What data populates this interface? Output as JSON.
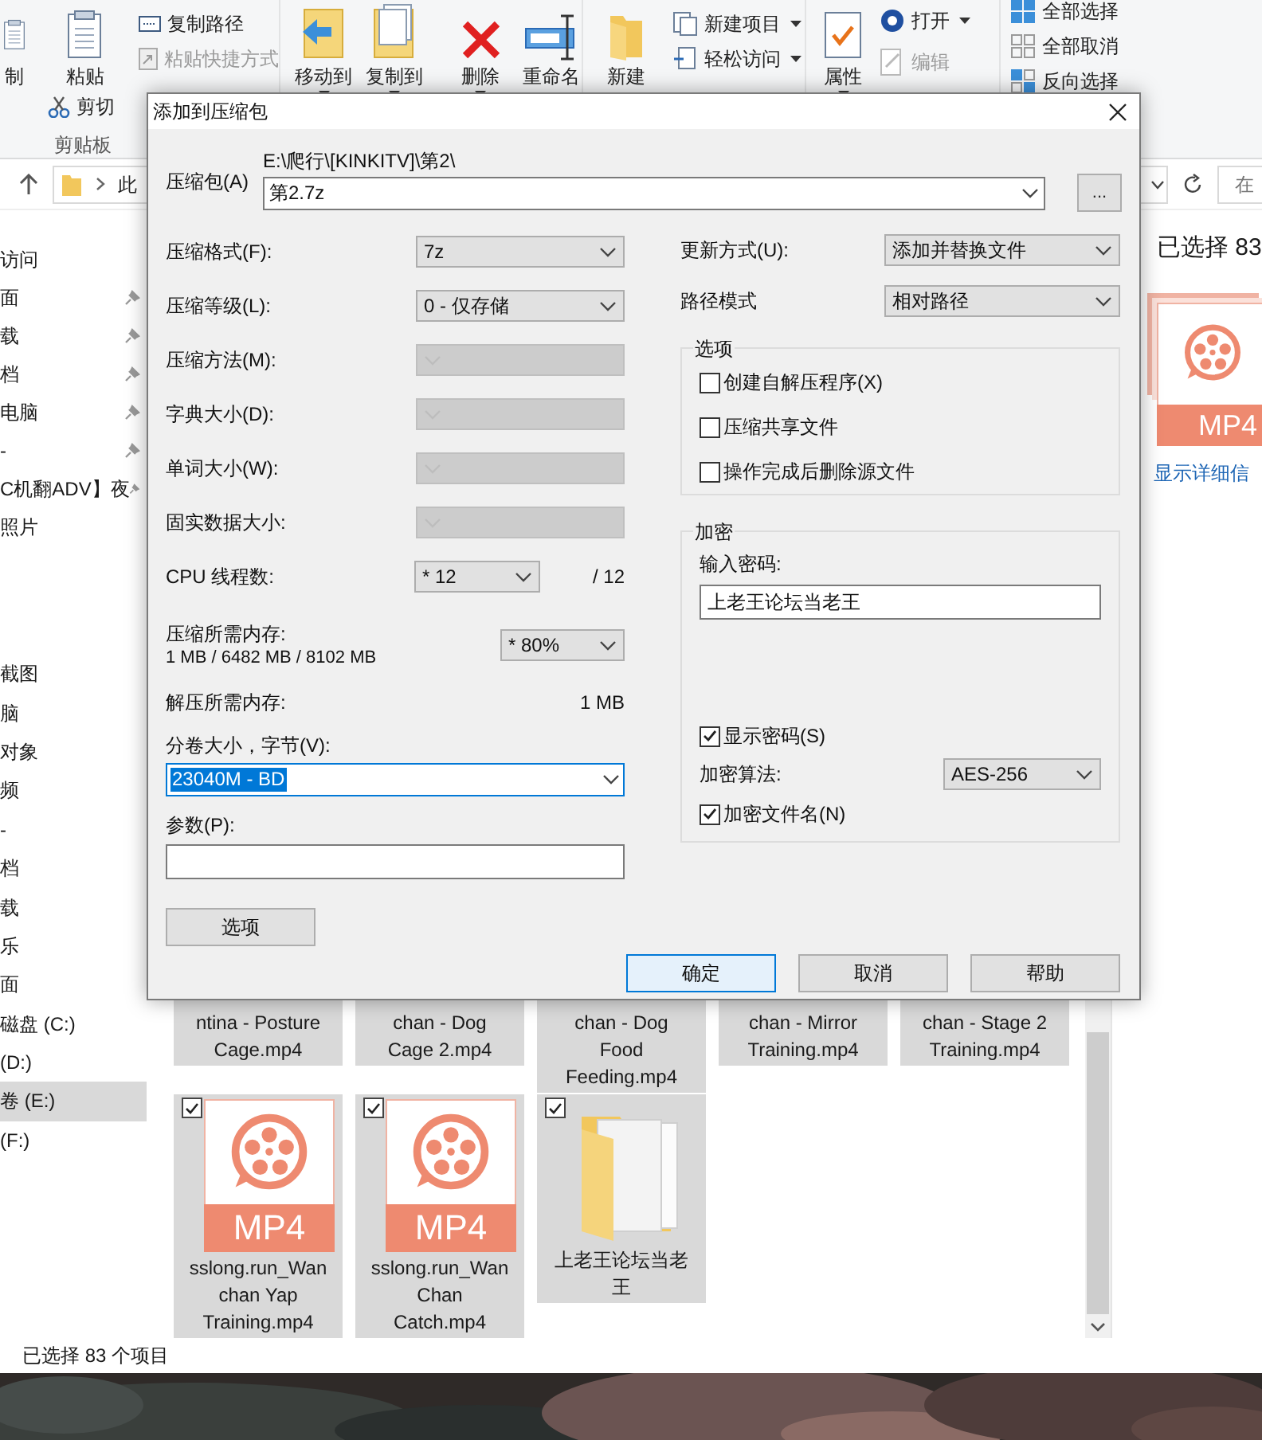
{
  "ribbon": {
    "clipboard": {
      "copy": "制",
      "paste": "粘贴",
      "copy_path": "复制路径",
      "paste_shortcut": "粘贴快捷方式",
      "cut": "剪切",
      "group_label": "剪贴板"
    },
    "organize": {
      "move_to": "移动到",
      "copy_to": "复制到",
      "delete": "删除",
      "rename": "重命名"
    },
    "new": {
      "new_folder": "新建",
      "new_item": "新建项目",
      "easy_access": "轻松访问"
    },
    "open": {
      "properties": "属性",
      "open": "打开",
      "edit": "编辑",
      "edit_disabled": true
    },
    "select": {
      "select_all": "全部选择",
      "select_none": "全部取消",
      "invert_selection": "反向选择"
    }
  },
  "address_bar": {
    "path": "此",
    "search_placeholder": "在"
  },
  "navigation": {
    "quick_access": [
      {
        "label": "访问",
        "pinned": false
      },
      {
        "label": "面",
        "pinned": true
      },
      {
        "label": "载",
        "pinned": true
      },
      {
        "label": "档",
        "pinned": true
      },
      {
        "label": "电脑",
        "pinned": true
      },
      {
        "label": "-",
        "pinned": true
      },
      {
        "label": "C机翻ADV】夜",
        "pinned": true
      },
      {
        "label": "照片",
        "pinned": false
      }
    ],
    "this_pc": [
      {
        "label": "截图",
        "selected": false
      },
      {
        "label": "脑",
        "selected": false
      },
      {
        "label": "对象",
        "selected": false
      },
      {
        "label": "频",
        "selected": false
      },
      {
        "label": "-",
        "selected": false
      },
      {
        "label": "档",
        "selected": false
      },
      {
        "label": "载",
        "selected": false
      },
      {
        "label": "乐",
        "selected": false
      },
      {
        "label": "面",
        "selected": false
      },
      {
        "label": "磁盘 (C:)",
        "selected": false
      },
      {
        "label": "(D:)",
        "selected": false
      },
      {
        "label": "卷 (E:)",
        "selected": true
      },
      {
        "label": "(F:)",
        "selected": false
      }
    ]
  },
  "file_rows": [
    [
      {
        "name": "ntina - Posture\nCage.mp4",
        "selected": true
      },
      {
        "name": "chan - Dog\nCage 2.mp4",
        "selected": true
      },
      {
        "name": "chan - Dog\nFood\nFeeding.mp4",
        "selected": true
      },
      {
        "name": "chan - Mirror\nTraining.mp4",
        "selected": true
      },
      {
        "name": "chan - Stage 2\nTraining.mp4",
        "selected": true
      }
    ],
    [
      {
        "kind": "video",
        "badge": "MP4",
        "name": "sslong.run_Wan\nchan  Yap\nTraining.mp4",
        "selected": true,
        "checked": true
      },
      {
        "kind": "video",
        "badge": "MP4",
        "name": "sslong.run_Wan\nChan\nCatch.mp4",
        "selected": true,
        "checked": true
      },
      {
        "kind": "folder",
        "name": "上老王论坛当老王",
        "selected": true,
        "checked": true
      }
    ]
  ],
  "details_pane": {
    "selection": "已选择 83",
    "badge": "MP4",
    "link": "显示详细信"
  },
  "status_bar": {
    "text": "已选择 83 个项目"
  },
  "dialog": {
    "title": "添加到压缩包",
    "archive": {
      "label": "压缩包(A)",
      "folder": "E:\\爬行\\[KINKITV]\\第2\\",
      "name": "第2.7z",
      "browse": "..."
    },
    "settings": [
      {
        "label": "压缩格式(F):",
        "value": "7z",
        "disabled": false
      },
      {
        "label": "压缩等级(L):",
        "value": "0 - 仅存储",
        "disabled": false
      },
      {
        "label": "压缩方法(M):",
        "disabled": true
      },
      {
        "label": "字典大小(D):",
        "disabled": true
      },
      {
        "label": "单词大小(W):",
        "disabled": true
      },
      {
        "label": "固实数据大小:",
        "disabled": true
      }
    ],
    "cpu_threads": {
      "label": "CPU 线程数:",
      "value": "* 12",
      "max": "/ 12"
    },
    "memory": {
      "label": "压缩所需内存:",
      "detail": "1 MB / 6482 MB / 8102 MB",
      "value": "* 80%"
    },
    "decompress_memory": {
      "label": "解压所需内存:",
      "value": "1 MB"
    },
    "volume": {
      "label": "分卷大小，字节(V):",
      "value": "23040M - BD",
      "selected": true
    },
    "parameters": {
      "label": "参数(P):"
    },
    "options_button": "选项",
    "update_mode": {
      "label": "更新方式(U):",
      "value": "添加并替换文件"
    },
    "path_mode": {
      "label": "路径模式",
      "value": "相对路径"
    },
    "options": {
      "title": "选项",
      "checkboxes": [
        {
          "label": "创建自解压程序(X)",
          "checked": false
        },
        {
          "label": "压缩共享文件",
          "checked": false
        },
        {
          "label": "操作完成后删除源文件",
          "checked": false
        }
      ]
    },
    "encryption": {
      "title": "加密",
      "password_label": "输入密码:",
      "password": "上老王论坛当老王",
      "show_password": {
        "label": "显示密码(S)",
        "checked": true
      },
      "method_label": "加密算法:",
      "method": "AES-256",
      "encrypt_names": {
        "label": "加密文件名(N)",
        "checked": true
      }
    },
    "buttons": [
      {
        "label": "确定",
        "selected": true
      },
      {
        "label": "取消",
        "selected": false
      },
      {
        "label": "帮助",
        "selected": false
      }
    ]
  }
}
